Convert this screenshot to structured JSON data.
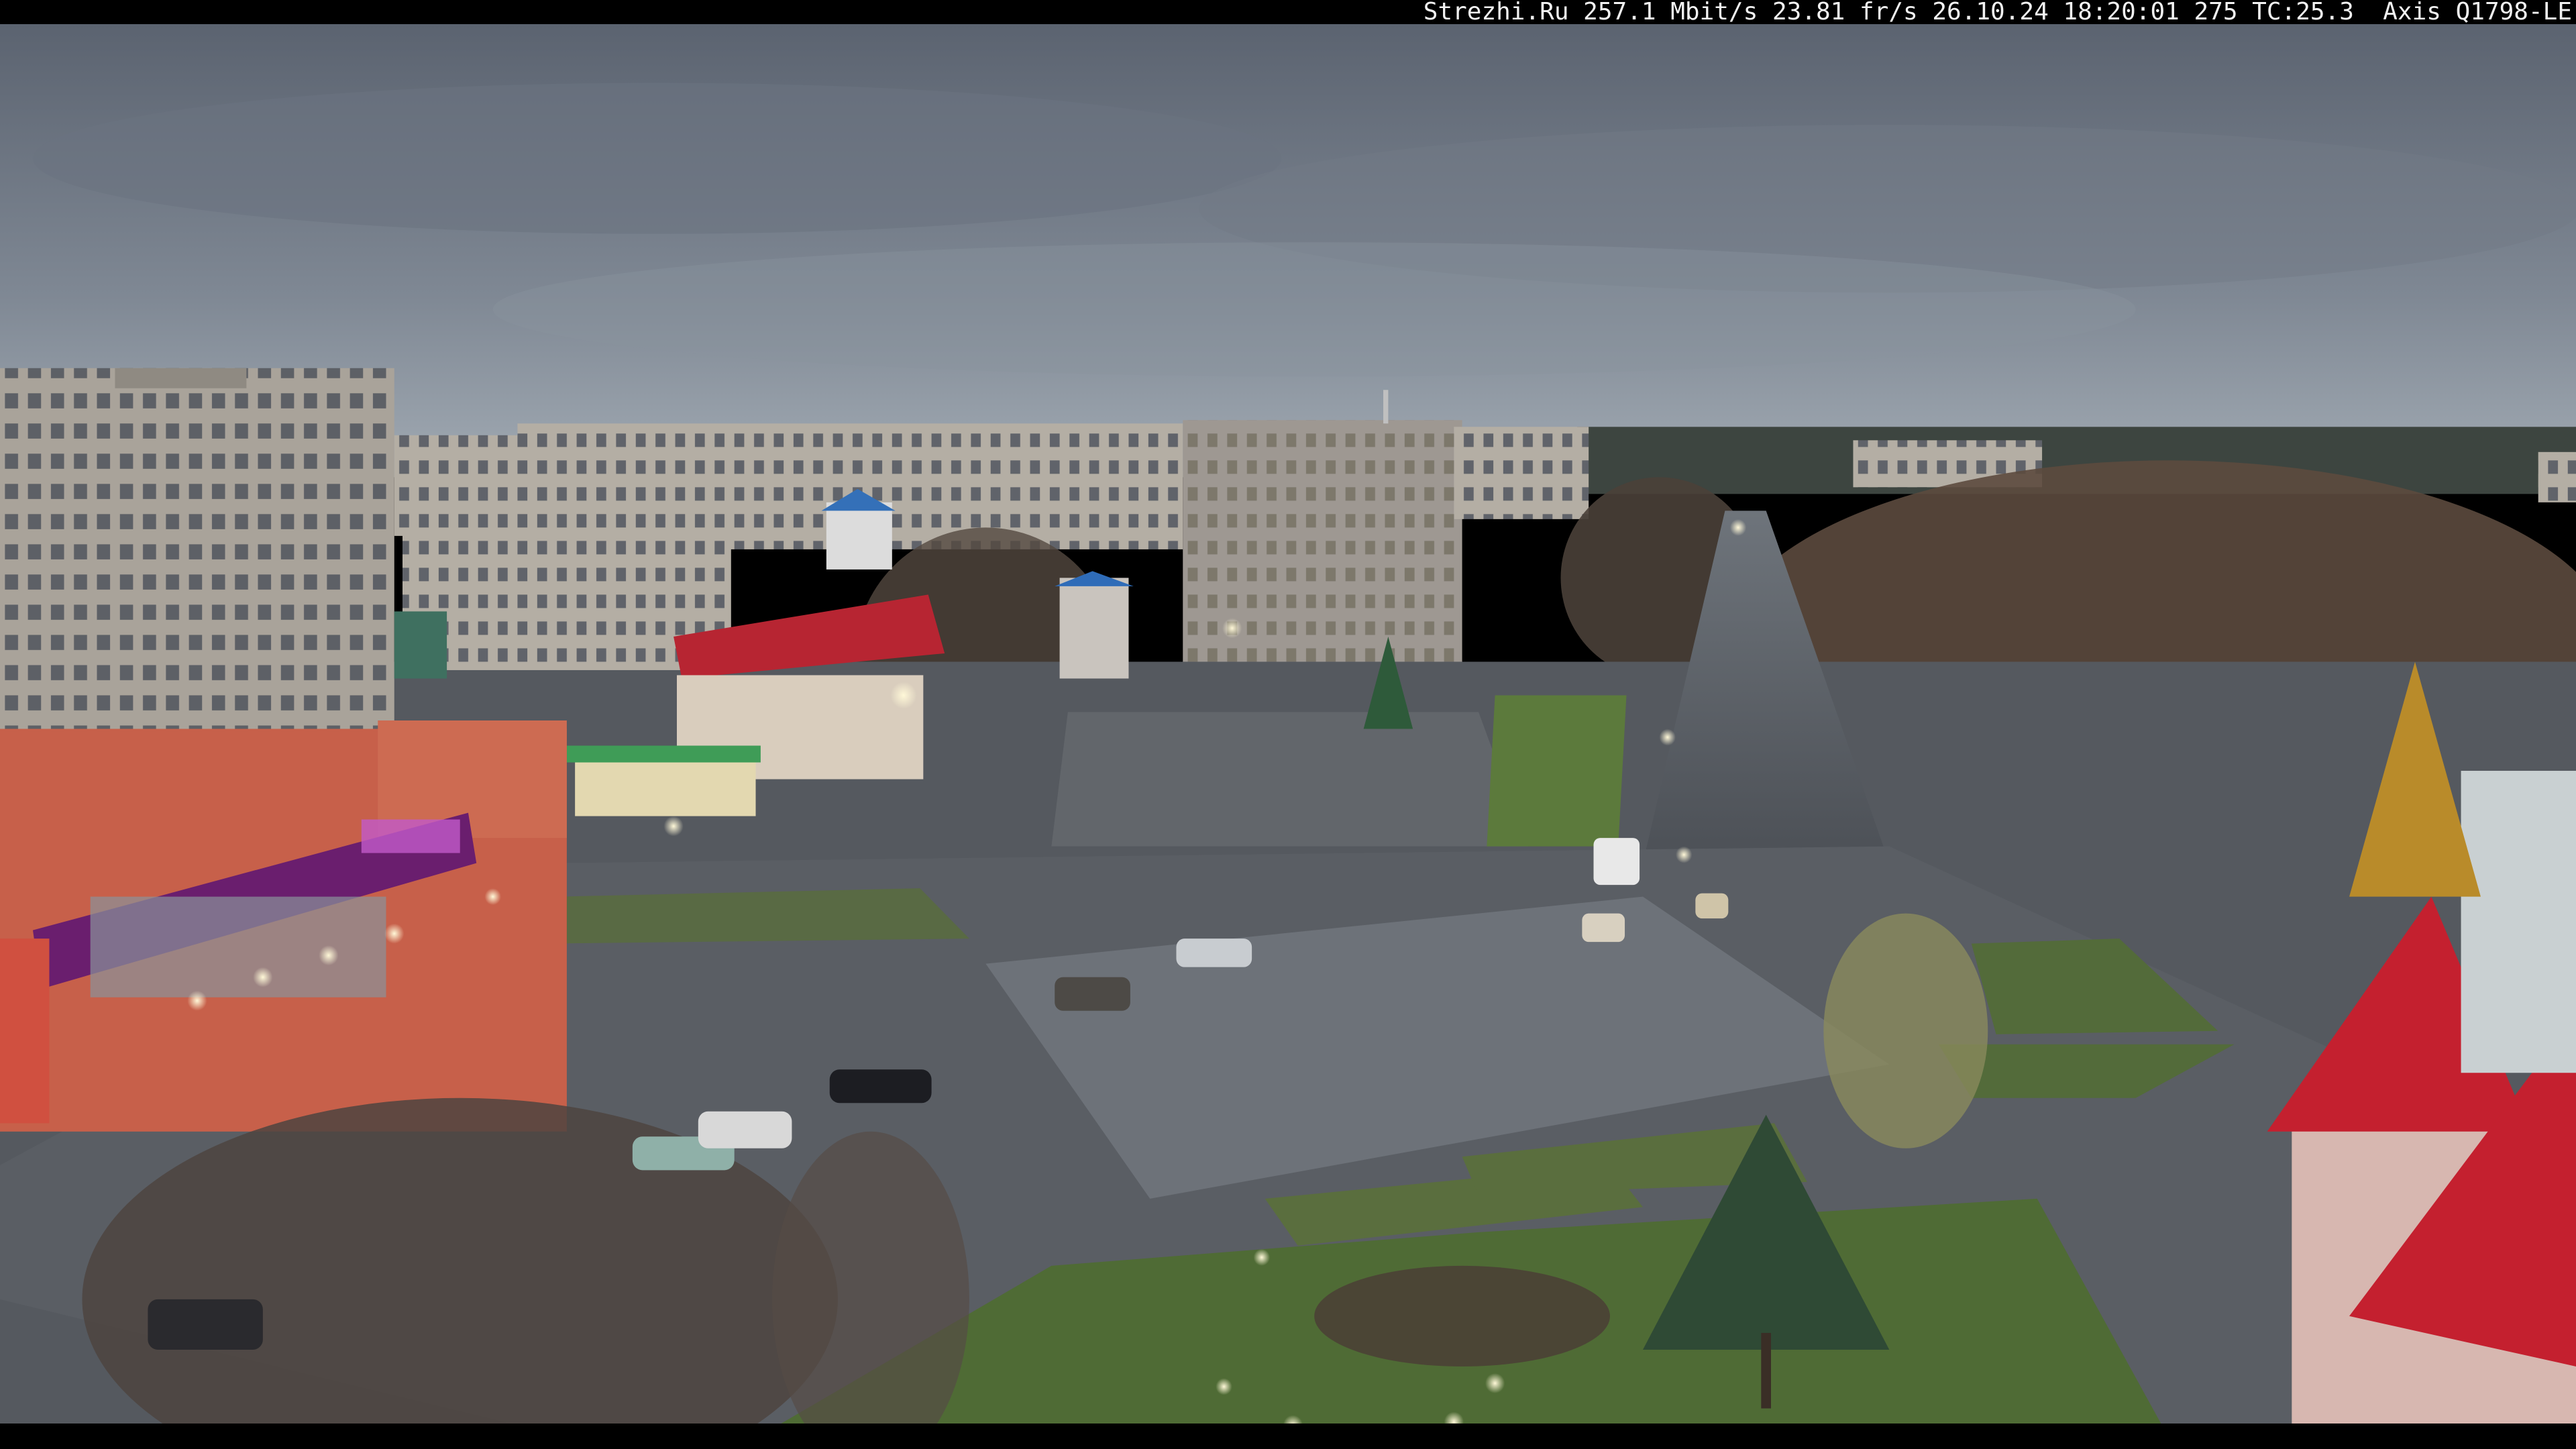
{
  "overlay": {
    "text": "Strezhi.Ru 257.1 Mbit/s 23.81 fr/s 26.10.24 18:20:01 275 TC:25.3  Axis Q1798-LE"
  },
  "colors": {
    "sky_top": "#626a78",
    "sky_horizon": "#99a3ad",
    "asphalt": "#52565c",
    "wet_asphalt_light": "#7c828a",
    "grass": "#4f6b35",
    "brick": "#c7604a",
    "red_roof": "#b8202c",
    "store_sign": "#6a1e6e",
    "streetlight": "#fff4c8"
  }
}
